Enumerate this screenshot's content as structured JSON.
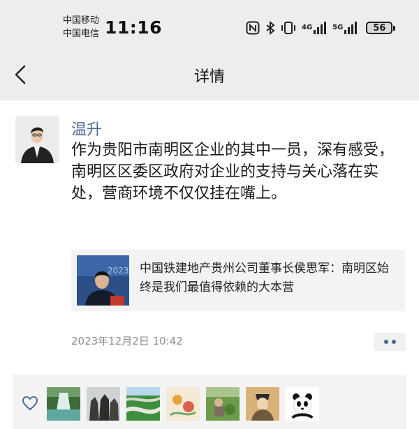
{
  "status_bar": {
    "carrier_1": "中国移动",
    "carrier_2": "中国电信",
    "time": "11:16",
    "network_1": "4G",
    "network_2": "5G",
    "battery": "56",
    "icons": [
      "nfc-icon",
      "bluetooth-icon",
      "vibrate-icon",
      "signal-4g-icon",
      "signal-5g-icon",
      "battery-icon"
    ]
  },
  "nav": {
    "back_icon": "chevron-left-icon",
    "title": "详情"
  },
  "post": {
    "author": "温升",
    "text": "作为贵阳市南明区企业的其中一员，深有感受，南明区区委区政府对企业的支持与关心落在实处，营商环境不仅仅挂在嘴上。",
    "link_card": {
      "title": "中国铁建地产贵州公司董事长侯思军：南明区始终是我们最值得依赖的大本营",
      "thumb_watermark": "2023"
    },
    "timestamp": "2023年12月2日 10:42",
    "more_icon": "more-dots-icon"
  },
  "likes": {
    "icon": "heart-outline-icon",
    "avatars": [
      "waterfall",
      "statues",
      "terraced-road",
      "illustration",
      "tea-picking",
      "painted-figure",
      "panda"
    ]
  },
  "colors": {
    "accent_name": "#4a6b9a",
    "top_bar": "#ededed",
    "card_bg": "#f3f3f3",
    "timestamp": "#8a8a8a"
  }
}
